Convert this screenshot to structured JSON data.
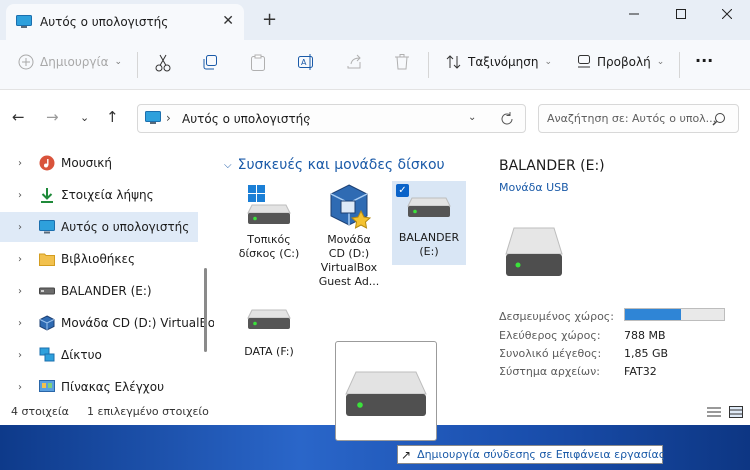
{
  "window": {
    "tab_title": "Αυτός ο υπολογιστής",
    "new_tab": "+",
    "close_tab": "✕"
  },
  "toolbar": {
    "create_label": "Δημιουργία",
    "sort_label": "Ταξινόμηση",
    "view_label": "Προβολή",
    "more_label": "···"
  },
  "address": {
    "path": "Αυτός ο υπολογιστής",
    "search_placeholder": "Αναζήτηση σε: Αυτός ο υπολ..."
  },
  "sidebar": {
    "items": [
      {
        "label": "Μουσική",
        "icon": "music-icon"
      },
      {
        "label": "Στοιχεία λήψης",
        "icon": "download-icon"
      },
      {
        "label": "Αυτός ο υπολογιστής",
        "icon": "computer-icon"
      },
      {
        "label": "Βιβλιοθήκες",
        "icon": "folder-icon"
      },
      {
        "label": "BALANDER (E:)",
        "icon": "usb-drive-icon"
      },
      {
        "label": "Μονάδα CD (D:) VirtualBo",
        "icon": "virtualbox-icon"
      },
      {
        "label": "Δίκτυο",
        "icon": "network-icon"
      },
      {
        "label": "Πίνακας Ελέγχου",
        "icon": "control-panel-icon"
      }
    ]
  },
  "content": {
    "group_title": "Συσκευές και μονάδες δίσκου",
    "drives": [
      {
        "line1": "Τοπικός",
        "line2": "δίσκος (C:)",
        "line3": "",
        "line4": ""
      },
      {
        "line1": "Μονάδα",
        "line2": "CD (D:)",
        "line3": "VirtualBox",
        "line4": "Guest Ad..."
      },
      {
        "line1": "BALANDER",
        "line2": "(E:)",
        "line3": "",
        "line4": ""
      },
      {
        "line1": "DATA (F:)",
        "line2": "",
        "line3": "",
        "line4": ""
      }
    ]
  },
  "details": {
    "title": "BALANDER (E:)",
    "subtitle": "Μονάδα USB",
    "used_label": "Δεσμευμένος χώρος:",
    "used_fraction": 0.57,
    "free_label": "Ελεύθερος χώρος:",
    "free_value": "788 MB",
    "total_label": "Συνολικό μέγεθος:",
    "total_value": "1,85 GB",
    "fs_label": "Σύστημα αρχείων:",
    "fs_value": "FAT32"
  },
  "status": {
    "count": "4 στοιχεία",
    "selected": "1 επιλεγμένο στοιχείο"
  },
  "tooltip": {
    "arrow": "↗",
    "text": "Δημιουργία σύνδεσης σε Επιφάνεια εργασίας"
  },
  "colors": {
    "accent": "#0a63c9",
    "link": "#1a5aa8",
    "usage": "#2f85d6"
  }
}
